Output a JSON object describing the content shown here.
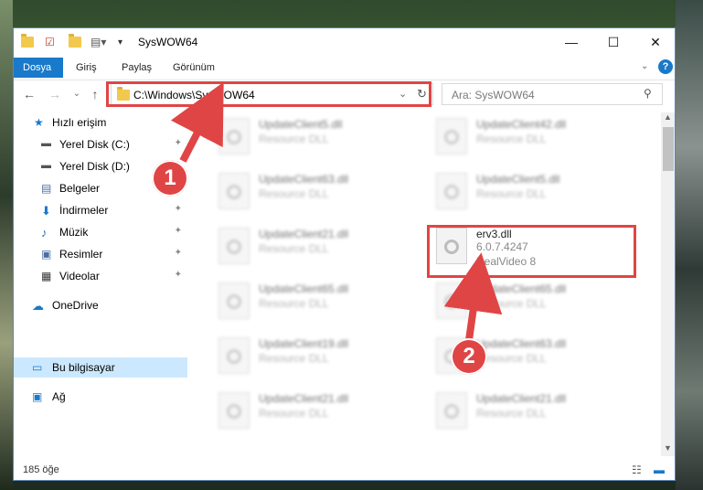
{
  "window": {
    "title": "SysWOW64",
    "minimize": "—",
    "maximize": "☐",
    "close": "✕"
  },
  "ribbon": {
    "tabs": [
      {
        "label": "Dosya"
      },
      {
        "label": "Giriş"
      },
      {
        "label": "Paylaş"
      },
      {
        "label": "Görünüm"
      }
    ],
    "help": "?"
  },
  "nav": {
    "address": "C:\\Windows\\SysWOW64",
    "search_placeholder": "Ara: SysWOW64"
  },
  "sidebar": {
    "items": [
      {
        "label": "Hızlı erişim"
      },
      {
        "label": "Yerel Disk (C:)"
      },
      {
        "label": "Yerel Disk (D:)"
      },
      {
        "label": "Belgeler"
      },
      {
        "label": "İndirmeler"
      },
      {
        "label": "Müzik"
      },
      {
        "label": "Resimler"
      },
      {
        "label": "Videolar"
      },
      {
        "label": "OneDrive"
      },
      {
        "label": "Bu bilgisayar"
      },
      {
        "label": "Ağ"
      }
    ]
  },
  "files": {
    "left": [
      {
        "name": "UpdateClient5.dll",
        "type": "Resource DLL"
      },
      {
        "name": "UpdateClient63.dll",
        "type": "Resource DLL"
      },
      {
        "name": "UpdateClient21.dll",
        "type": "Resource DLL"
      },
      {
        "name": "UpdateClient65.dll",
        "type": "Resource DLL"
      },
      {
        "name": "UpdateClient19.dll",
        "type": "Resource DLL"
      },
      {
        "name": "UpdateClient21.dll",
        "type": "Resource DLL"
      }
    ],
    "right": [
      {
        "name": "UpdateClient42.dll",
        "type": "Resource DLL"
      },
      {
        "name": "UpdateClient5.dll",
        "type": "Resource DLL"
      },
      {
        "name": "erv3.dll",
        "version": "6.0.7.4247",
        "type": "RealVideo 8"
      },
      {
        "name": "UpdateClient65.dll",
        "type": "Resource DLL"
      },
      {
        "name": "UpdateClient63.dll",
        "type": "Resource DLL"
      },
      {
        "name": "UpdateClient21.dll",
        "type": "Resource DLL"
      }
    ]
  },
  "status": {
    "count": "185 öğe"
  },
  "annotations": {
    "step1": "1",
    "step2": "2"
  },
  "colors": {
    "accent": "#1979ca",
    "highlight": "#e04545"
  }
}
